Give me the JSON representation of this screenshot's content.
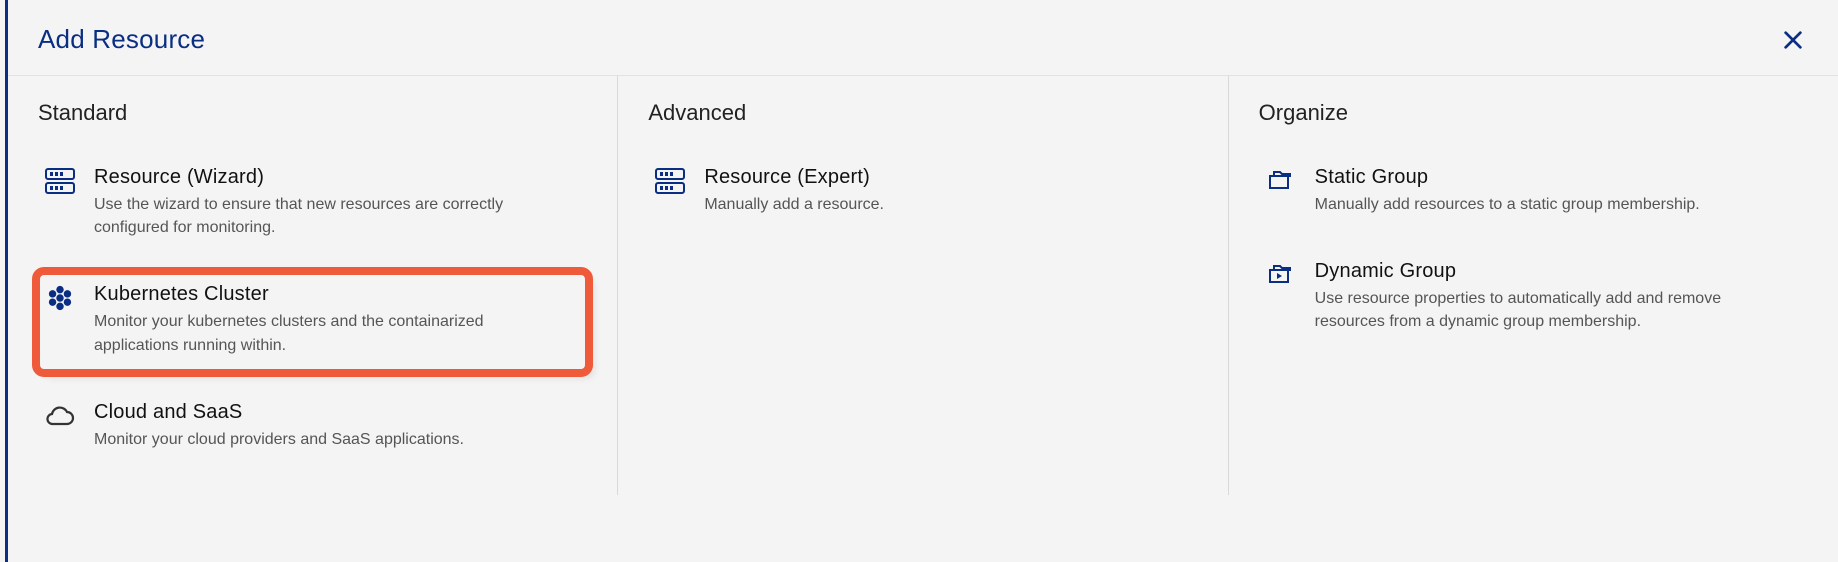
{
  "header": {
    "title": "Add Resource"
  },
  "columns": {
    "standard": {
      "title": "Standard",
      "options": {
        "wizard": {
          "title": "Resource (Wizard)",
          "desc": "Use the wizard to ensure that new resources are correctly configured for monitoring."
        },
        "kubernetes": {
          "title": "Kubernetes Cluster",
          "desc": "Monitor your kubernetes clusters and the containarized applications running within."
        },
        "cloud": {
          "title": "Cloud and SaaS",
          "desc": "Monitor your cloud providers and SaaS applications."
        }
      }
    },
    "advanced": {
      "title": "Advanced",
      "options": {
        "expert": {
          "title": "Resource (Expert)",
          "desc": "Manually add a resource."
        }
      }
    },
    "organize": {
      "title": "Organize",
      "options": {
        "static": {
          "title": "Static Group",
          "desc": "Manually add resources to a static group membership."
        },
        "dynamic": {
          "title": "Dynamic Group",
          "desc": "Use resource properties to automatically add and remove resources from a dynamic group membership."
        }
      }
    }
  }
}
